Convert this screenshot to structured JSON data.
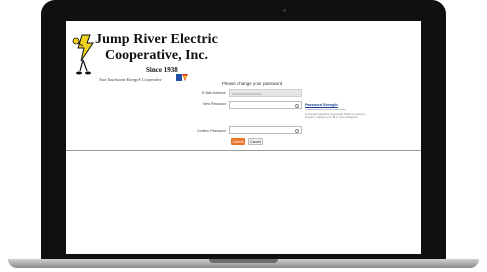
{
  "header": {
    "company_line1": "Jump River Electric",
    "company_line2": "Cooperative, Inc.",
    "since": "Since 1938",
    "tagline": "Your Touchstone Energy® Cooperative"
  },
  "form": {
    "prompt": "Please change your password",
    "email_label": "E-Mail Address",
    "new_password_label": "New Password",
    "confirm_password_label": "Confirm Password",
    "security_link": "Password Strength",
    "hint": "A stronger password, is generally harder to guess by humans, requires up to 48 or more characters.",
    "submit_label": "Submit",
    "cancel_label": "Cancel"
  },
  "colors": {
    "accent": "#e8742a",
    "link": "#1a3f8f"
  },
  "icons": {
    "mascot": "lightning-bulb-mascot",
    "touchstone": "touchstone-energy-logo",
    "eye": "eye-icon"
  }
}
